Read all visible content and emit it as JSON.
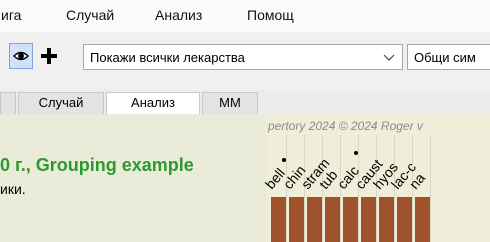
{
  "menu": [
    "ига",
    "Случай",
    "Анализ",
    "Помощ"
  ],
  "toolbar": {
    "show_all_remedies_combo": "Покажи всички лекарства",
    "second_combo": "Общи сим",
    "combo_arrow_icon": "chevron-down-icon"
  },
  "tabs": [
    {
      "label": "Случай",
      "active": false
    },
    {
      "label": "Анализ",
      "active": true
    },
    {
      "label": "MM",
      "active": false
    }
  ],
  "content": {
    "copyright": "pertory 2024 © 2024 Roger v",
    "title": "0 г., Grouping example",
    "subtitle": "ики."
  },
  "remedies": [
    "bell",
    "chin",
    "stram",
    "tub",
    "calc",
    "caust",
    "hyos",
    "lac-c",
    "na"
  ],
  "colors": {
    "bar": "#a0522d",
    "title": "#2c9a2c"
  }
}
